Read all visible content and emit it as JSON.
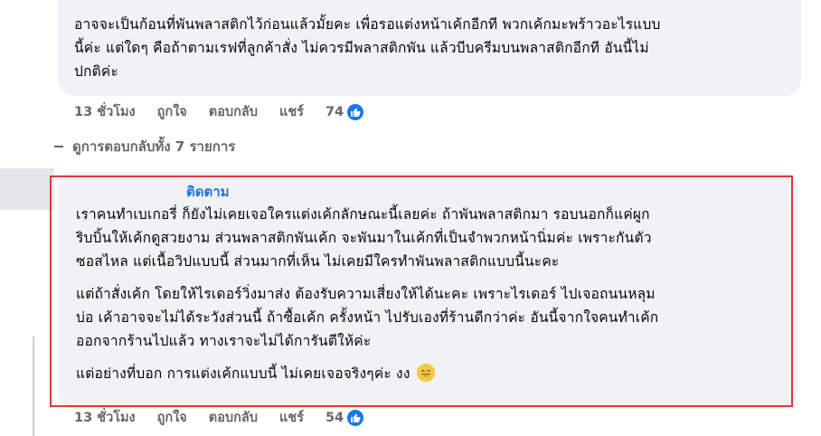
{
  "comment1": {
    "lines": [
      "อาจจะเป็นก้อนที่พันพลาสติกไว้ก่อนแล้วมั้ยคะ เพื่อรอแต่งหน้าเค้กอีกที พวกเค้กมะพร้าวอะไรแบบ",
      "นี้ค่ะ แต่ใดๆ คือถ้าตามเรฟที่ลูกค้าสั่ง ไม่ควรมีพลาสติกพัน แล้วบีบครีมบนพลาสติกอีกที อันนี้ไม่",
      "ปกติค่ะ"
    ],
    "time": "13 ชั่วโมง",
    "like": "ถูกใจ",
    "reply": "ตอบกลับ",
    "share": "แชร์",
    "reactions": "74"
  },
  "replies_toggle": "ดูการตอบกลับทั้ง 7 รายการ",
  "comment2": {
    "author": "ติดตาม",
    "paragraphs": [
      [
        "เราคนทำเบเกอรี่ ก็ยังไม่เคยเจอใครแต่งเค้กลักษณะนี้เลยค่ะ ถ้าพันพลาสติกมา รอบนอกก็แค่ผูก",
        "ริบบิ้นให้เค้กดูสวยงาม ส่วนพลาสติกพันเค้ก จะพันมาในเค้กที่เป็นจำพวกหน้านิ่มค่ะ เพราะกันตัว",
        "ซอสไหล แต่เนื้อวิปแบบนี้ ส่วนมากที่เห็น ไม่เคยมีใครทำพันพลาสติกแบบนี้นะคะ"
      ],
      [
        "แต่ถ้าสั่งเค้ก โดยให้ไรเดอร์วิ่งมาส่ง ต้องรับความเสี่ยงให้ได้นะคะ เพราะไรเดอร์ ไปเจอถนนหลุม",
        "บ่อ เค้าอาจจะไม่ได้ระวังส่วนนี้ ถ้าซื้อเค้ก ครั้งหน้า ไปรับเองที่ร้านดีกว่าค่ะ อันนี้จากใจคนทำเค้ก",
        "ออกจากร้านไปแล้ว ทางเราจะไม่ได้การันตีให้ค่ะ"
      ],
      [
        "แต่อย่างที่บอก การแต่งเค้กแบบนี้ ไม่เคยเจอจริงๆค่ะ งง"
      ]
    ],
    "time": "13 ชั่วโมง",
    "like": "ถูกใจ",
    "reply": "ตอบกลับ",
    "share": "แชร์",
    "reactions": "54"
  },
  "colors": {
    "bubble": "#f0f2f5",
    "highlight": "#e03939",
    "link": "#1b74e4",
    "meta": "#65676b",
    "like": "#1877f2"
  },
  "icons": [
    "thumbs-up-icon",
    "grinning-emoji-icon"
  ]
}
